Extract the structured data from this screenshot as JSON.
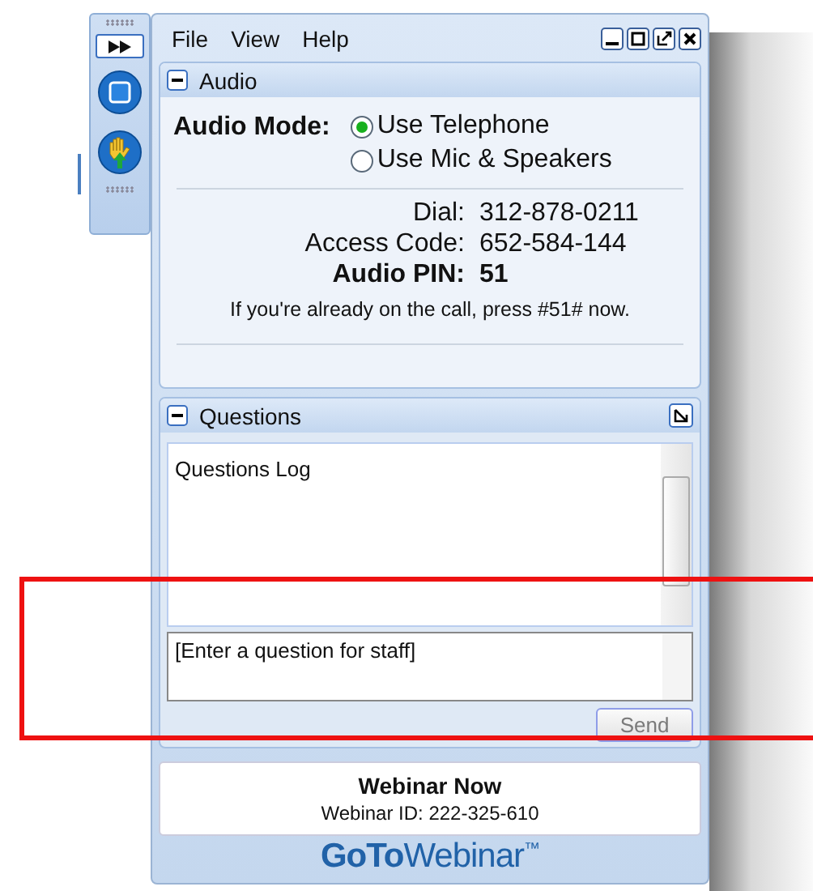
{
  "menu": [
    "File",
    "View",
    "Help"
  ],
  "audio": {
    "title": "Audio",
    "mode_label": "Audio Mode:",
    "options": [
      {
        "label": "Use Telephone",
        "selected": true
      },
      {
        "label": "Use Mic & Speakers",
        "selected": false
      }
    ],
    "details": [
      {
        "label": "Dial:",
        "value": "312-878-0211",
        "emphasis": false
      },
      {
        "label": "Access Code:",
        "value": "652-584-144",
        "emphasis": false
      },
      {
        "label": "Audio PIN:",
        "value": "51",
        "emphasis": true
      }
    ],
    "note": "If you're already on the call, press #51# now."
  },
  "questions": {
    "title": "Questions",
    "log": "Questions Log",
    "placeholder": "[Enter a question for staff]",
    "send": {
      "label": "Send",
      "disabled": true
    }
  },
  "footer": {
    "title": "Webinar Now",
    "webinar_id": "Webinar ID: 222-325-610",
    "logo": "**GoTo**Webinar$^{™}$"
  }
}
